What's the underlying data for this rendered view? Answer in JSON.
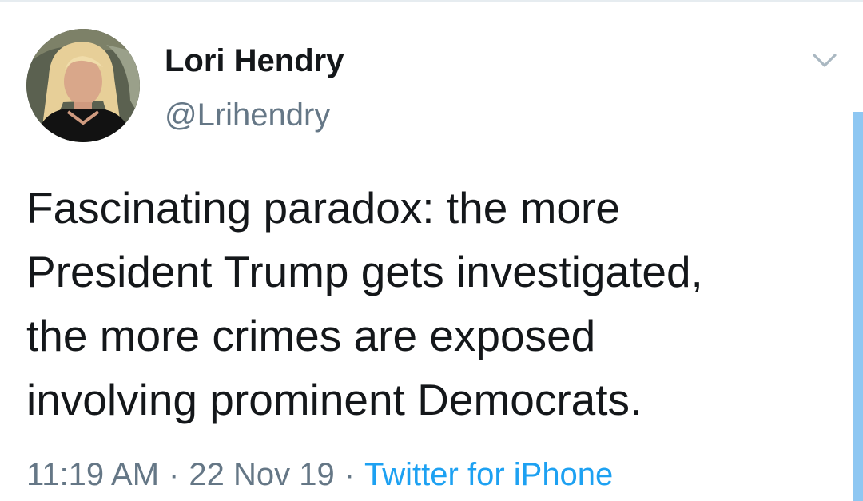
{
  "tweet": {
    "author": {
      "display_name": "Lori Hendry",
      "handle": "@Lrihendry"
    },
    "text_lines": [
      "Fascinating paradox: the more",
      "President Trump gets investigated,",
      "the more crimes are exposed",
      "involving prominent Democrats."
    ],
    "meta": {
      "time": "11:19 AM",
      "separator": "·",
      "date": "22 Nov 19",
      "source": "Twitter for iPhone"
    },
    "menu_icon": "chevron-down-icon"
  },
  "colors": {
    "text": "#14171a",
    "secondary_text": "#657786",
    "link": "#1da1f2",
    "scroll_indicator": "#8ec7f2",
    "divider": "#e6ecf0"
  }
}
